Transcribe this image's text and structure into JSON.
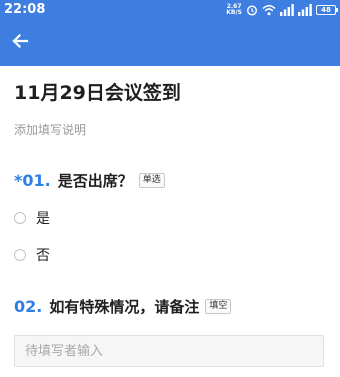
{
  "status_bar": {
    "time": "22:08",
    "net_speed_value": "2.67",
    "net_speed_unit": "KB/S",
    "battery": "48",
    "icons": [
      "alarm-icon",
      "wifi-icon",
      "signal-icon",
      "signal-icon",
      "battery-icon"
    ]
  },
  "toolbar": {
    "back_icon": "arrow-left-icon"
  },
  "form": {
    "title": "11月29日会议签到",
    "description": "添加填写说明"
  },
  "questions": [
    {
      "required_mark": "*",
      "number": "01.",
      "text": "是否出席？",
      "tag": "单选",
      "options": [
        "是",
        "否"
      ]
    },
    {
      "required_mark": "",
      "number": "02.",
      "text": "如有特殊情况，请备注",
      "tag": "填空",
      "placeholder": "待填写者输入"
    }
  ],
  "colors": {
    "header": "#3d7ee0",
    "accent": "#2f7ee8"
  }
}
